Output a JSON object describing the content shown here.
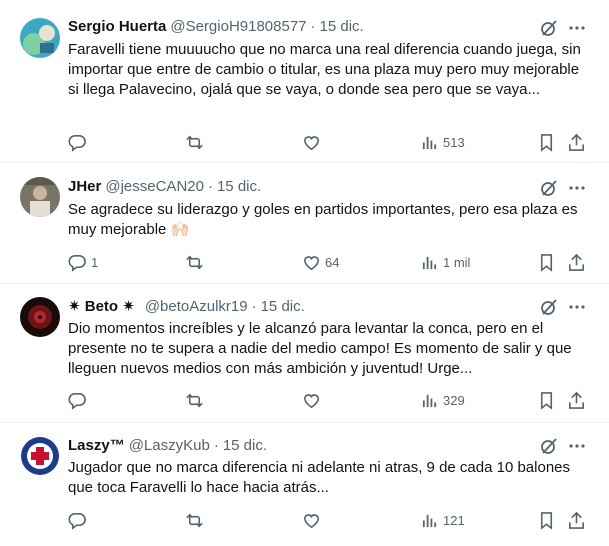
{
  "tweets": [
    {
      "name": "Sergio Huerta",
      "handle": "@SergioH91808577",
      "date": "15 dic.",
      "text": "Faravelli tiene muuuucho que no marca una real diferencia cuando juega, sin importar que entre de cambio o titular, es una plaza muy pero muy mejorable si llega Palavecino, ojalá que se vaya, o donde sea pero que se vaya...",
      "replies": "",
      "retweets": "",
      "likes": "",
      "views": "513"
    },
    {
      "name": "JHer",
      "handle": "@jesseCAN20",
      "date": "15 dic.",
      "text": "Se agradece su liderazgo y goles en partidos importantes, pero esa plaza es muy mejorable 🙌🏻",
      "replies": "1",
      "retweets": "",
      "likes": "64",
      "views": "1 mil"
    },
    {
      "name": "✷ Beto ✷",
      "handle": "@betoAzulkr19",
      "date": "15 dic.",
      "text": "Dio momentos increíbles y le alcanzó para levantar la conca, pero en el presente no te supera a nadie del medio campo! Es momento de salir y que lleguen nuevos medios con más ambición y juventud! Urge...",
      "replies": "",
      "retweets": "",
      "likes": "",
      "views": "329"
    },
    {
      "name": "Laszy™",
      "handle": "@LaszyKub",
      "date": "15 dic.",
      "text": "Jugador que no marca diferencia ni adelante ni atras, 9 de cada 10 balones que toca Faravelli lo hace hacia atrás...",
      "replies": "",
      "retweets": "",
      "likes": "",
      "views": "121"
    }
  ],
  "icons": {
    "reply": "reply-icon",
    "retweet": "retweet-icon",
    "like": "heart-icon",
    "views": "views-icon",
    "bookmark": "bookmark-icon",
    "share": "share-icon",
    "grok": "grok-icon",
    "more": "more-icon"
  },
  "colors": {
    "text": "#0f1419",
    "secondary": "#536471",
    "divider": "#eff3f4"
  }
}
